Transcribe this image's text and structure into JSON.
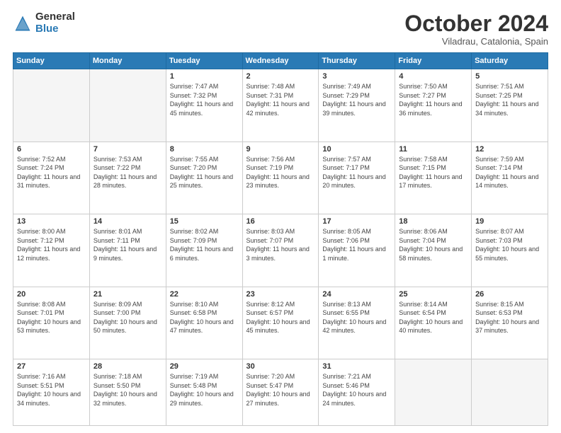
{
  "header": {
    "logo": {
      "general": "General",
      "blue": "Blue"
    },
    "title": "October 2024",
    "subtitle": "Viladrau, Catalonia, Spain"
  },
  "weekdays": [
    "Sunday",
    "Monday",
    "Tuesday",
    "Wednesday",
    "Thursday",
    "Friday",
    "Saturday"
  ],
  "weeks": [
    [
      {
        "day": "",
        "info": ""
      },
      {
        "day": "",
        "info": ""
      },
      {
        "day": "1",
        "info": "Sunrise: 7:47 AM\nSunset: 7:32 PM\nDaylight: 11 hours and 45 minutes."
      },
      {
        "day": "2",
        "info": "Sunrise: 7:48 AM\nSunset: 7:31 PM\nDaylight: 11 hours and 42 minutes."
      },
      {
        "day": "3",
        "info": "Sunrise: 7:49 AM\nSunset: 7:29 PM\nDaylight: 11 hours and 39 minutes."
      },
      {
        "day": "4",
        "info": "Sunrise: 7:50 AM\nSunset: 7:27 PM\nDaylight: 11 hours and 36 minutes."
      },
      {
        "day": "5",
        "info": "Sunrise: 7:51 AM\nSunset: 7:25 PM\nDaylight: 11 hours and 34 minutes."
      }
    ],
    [
      {
        "day": "6",
        "info": "Sunrise: 7:52 AM\nSunset: 7:24 PM\nDaylight: 11 hours and 31 minutes."
      },
      {
        "day": "7",
        "info": "Sunrise: 7:53 AM\nSunset: 7:22 PM\nDaylight: 11 hours and 28 minutes."
      },
      {
        "day": "8",
        "info": "Sunrise: 7:55 AM\nSunset: 7:20 PM\nDaylight: 11 hours and 25 minutes."
      },
      {
        "day": "9",
        "info": "Sunrise: 7:56 AM\nSunset: 7:19 PM\nDaylight: 11 hours and 23 minutes."
      },
      {
        "day": "10",
        "info": "Sunrise: 7:57 AM\nSunset: 7:17 PM\nDaylight: 11 hours and 20 minutes."
      },
      {
        "day": "11",
        "info": "Sunrise: 7:58 AM\nSunset: 7:15 PM\nDaylight: 11 hours and 17 minutes."
      },
      {
        "day": "12",
        "info": "Sunrise: 7:59 AM\nSunset: 7:14 PM\nDaylight: 11 hours and 14 minutes."
      }
    ],
    [
      {
        "day": "13",
        "info": "Sunrise: 8:00 AM\nSunset: 7:12 PM\nDaylight: 11 hours and 12 minutes."
      },
      {
        "day": "14",
        "info": "Sunrise: 8:01 AM\nSunset: 7:11 PM\nDaylight: 11 hours and 9 minutes."
      },
      {
        "day": "15",
        "info": "Sunrise: 8:02 AM\nSunset: 7:09 PM\nDaylight: 11 hours and 6 minutes."
      },
      {
        "day": "16",
        "info": "Sunrise: 8:03 AM\nSunset: 7:07 PM\nDaylight: 11 hours and 3 minutes."
      },
      {
        "day": "17",
        "info": "Sunrise: 8:05 AM\nSunset: 7:06 PM\nDaylight: 11 hours and 1 minute."
      },
      {
        "day": "18",
        "info": "Sunrise: 8:06 AM\nSunset: 7:04 PM\nDaylight: 10 hours and 58 minutes."
      },
      {
        "day": "19",
        "info": "Sunrise: 8:07 AM\nSunset: 7:03 PM\nDaylight: 10 hours and 55 minutes."
      }
    ],
    [
      {
        "day": "20",
        "info": "Sunrise: 8:08 AM\nSunset: 7:01 PM\nDaylight: 10 hours and 53 minutes."
      },
      {
        "day": "21",
        "info": "Sunrise: 8:09 AM\nSunset: 7:00 PM\nDaylight: 10 hours and 50 minutes."
      },
      {
        "day": "22",
        "info": "Sunrise: 8:10 AM\nSunset: 6:58 PM\nDaylight: 10 hours and 47 minutes."
      },
      {
        "day": "23",
        "info": "Sunrise: 8:12 AM\nSunset: 6:57 PM\nDaylight: 10 hours and 45 minutes."
      },
      {
        "day": "24",
        "info": "Sunrise: 8:13 AM\nSunset: 6:55 PM\nDaylight: 10 hours and 42 minutes."
      },
      {
        "day": "25",
        "info": "Sunrise: 8:14 AM\nSunset: 6:54 PM\nDaylight: 10 hours and 40 minutes."
      },
      {
        "day": "26",
        "info": "Sunrise: 8:15 AM\nSunset: 6:53 PM\nDaylight: 10 hours and 37 minutes."
      }
    ],
    [
      {
        "day": "27",
        "info": "Sunrise: 7:16 AM\nSunset: 5:51 PM\nDaylight: 10 hours and 34 minutes."
      },
      {
        "day": "28",
        "info": "Sunrise: 7:18 AM\nSunset: 5:50 PM\nDaylight: 10 hours and 32 minutes."
      },
      {
        "day": "29",
        "info": "Sunrise: 7:19 AM\nSunset: 5:48 PM\nDaylight: 10 hours and 29 minutes."
      },
      {
        "day": "30",
        "info": "Sunrise: 7:20 AM\nSunset: 5:47 PM\nDaylight: 10 hours and 27 minutes."
      },
      {
        "day": "31",
        "info": "Sunrise: 7:21 AM\nSunset: 5:46 PM\nDaylight: 10 hours and 24 minutes."
      },
      {
        "day": "",
        "info": ""
      },
      {
        "day": "",
        "info": ""
      }
    ]
  ]
}
